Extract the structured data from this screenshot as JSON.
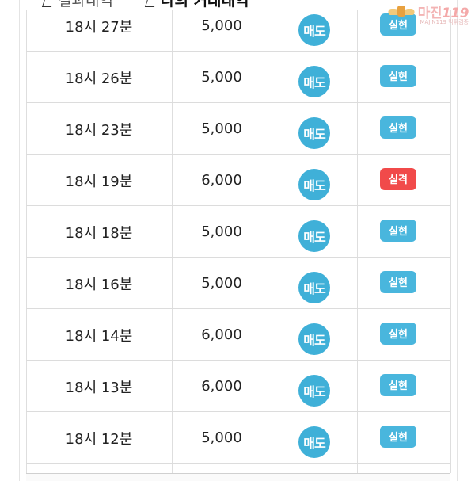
{
  "tabs": [
    {
      "label": "결과내역",
      "active": false
    },
    {
      "label": "나의 거래내역",
      "active": true
    }
  ],
  "watermark": {
    "text": "마진",
    "number": "119",
    "subtitle": "MAJIN119 먹튀검증"
  },
  "colors": {
    "sell_badge": "#3fb0d8",
    "result_success": "#49b6dd",
    "result_fail": "#f14a4a"
  },
  "trades": [
    {
      "time": "18시 27분",
      "amount": "5,000",
      "type": "매도",
      "result": "실현",
      "status": "success"
    },
    {
      "time": "18시 26분",
      "amount": "5,000",
      "type": "매도",
      "result": "실현",
      "status": "success"
    },
    {
      "time": "18시 23분",
      "amount": "5,000",
      "type": "매도",
      "result": "실현",
      "status": "success"
    },
    {
      "time": "18시 19분",
      "amount": "6,000",
      "type": "매도",
      "result": "실격",
      "status": "fail"
    },
    {
      "time": "18시 18분",
      "amount": "5,000",
      "type": "매도",
      "result": "실현",
      "status": "success"
    },
    {
      "time": "18시 16분",
      "amount": "5,000",
      "type": "매도",
      "result": "실현",
      "status": "success"
    },
    {
      "time": "18시 14분",
      "amount": "6,000",
      "type": "매도",
      "result": "실현",
      "status": "success"
    },
    {
      "time": "18시 13분",
      "amount": "6,000",
      "type": "매도",
      "result": "실현",
      "status": "success"
    },
    {
      "time": "18시 12분",
      "amount": "5,000",
      "type": "매도",
      "result": "실현",
      "status": "success"
    }
  ]
}
